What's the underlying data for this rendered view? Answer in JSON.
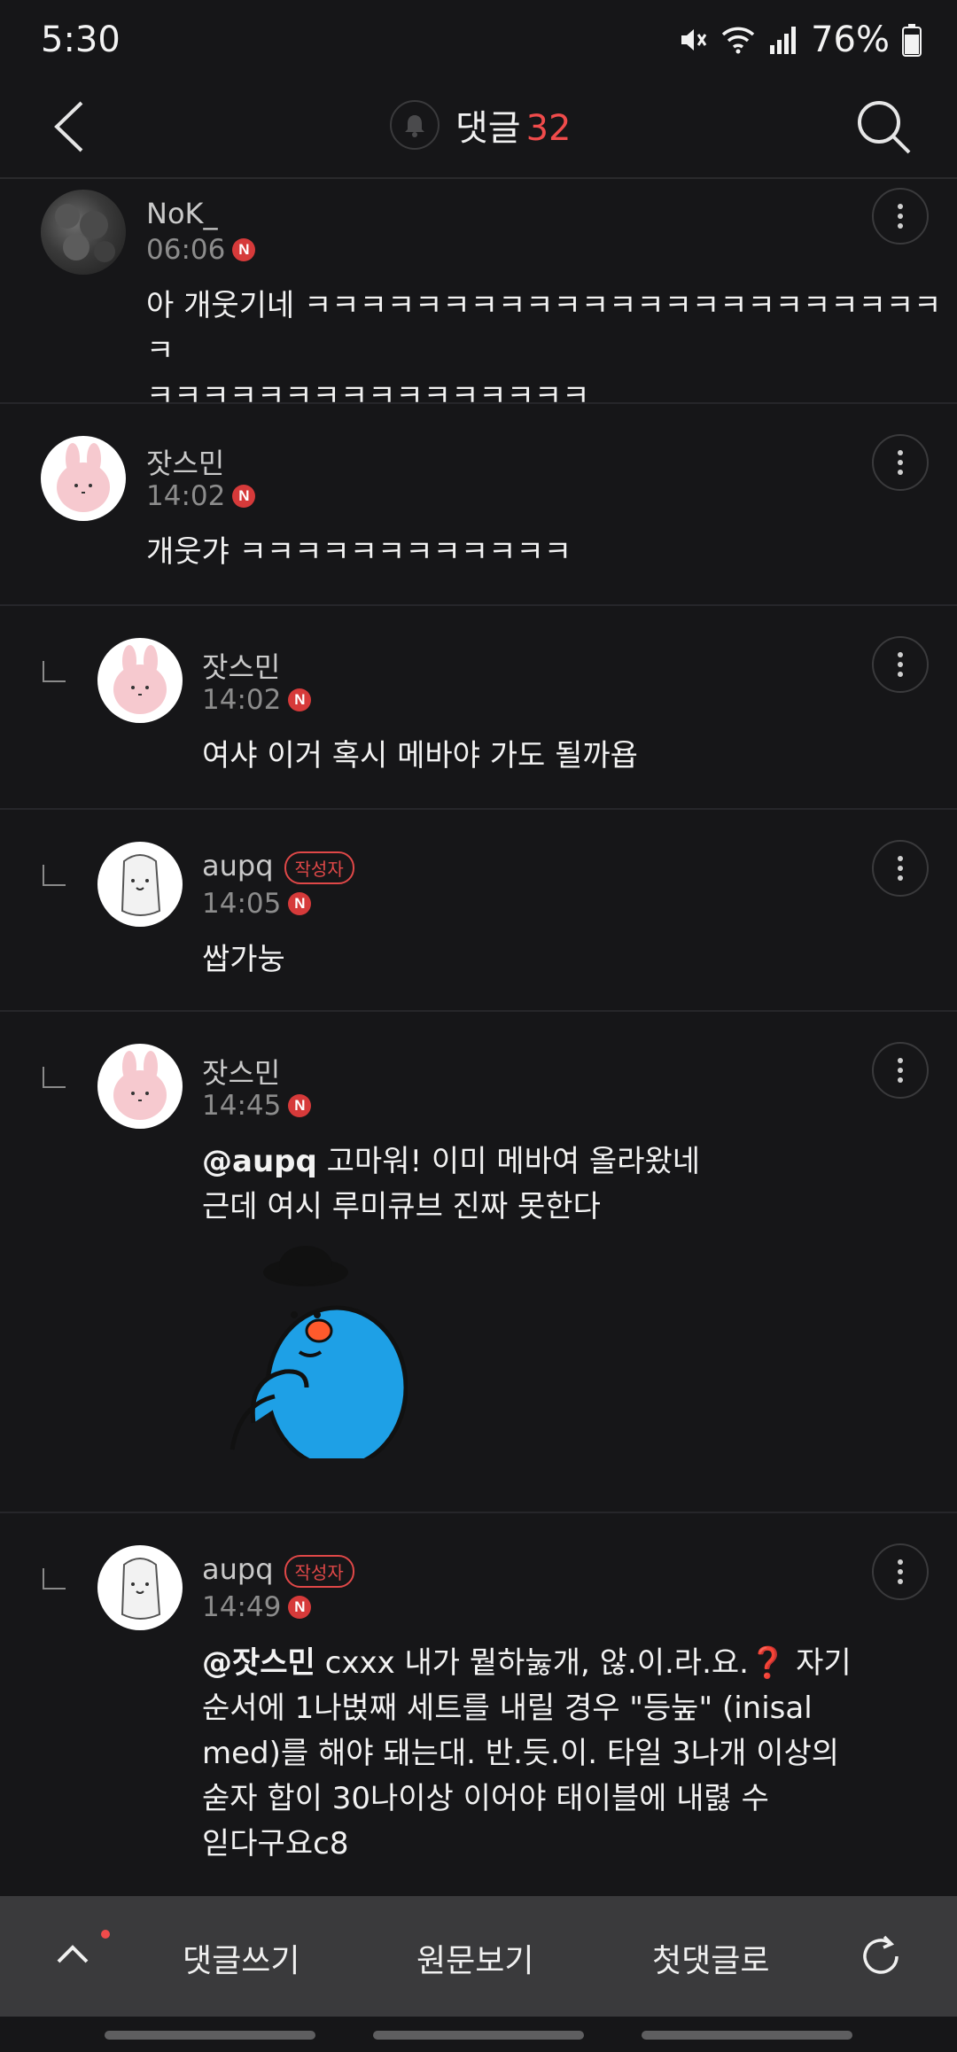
{
  "status": {
    "time": "5:30",
    "battery": "76%"
  },
  "header": {
    "title": "댓글",
    "count": "32"
  },
  "comments": [
    {
      "name": "NoK_",
      "time": "06:06",
      "text": [
        "아 개웃기네 ㅋㅋㅋㅋㅋㅋㅋㅋㅋㅋㅋㅋㅋㅋㅋㅋㅋㅋㅋㅋㅋㅋㅋㅋ",
        "ㅋㅋㅋㅋㅋㅋㅋㅋㅋㅋㅋㅋㅋㅋㅋㅋ"
      ]
    },
    {
      "name": "잣스민",
      "time": "14:02",
      "text": [
        "개웃갸 ㅋㅋㅋㅋㅋㅋㅋㅋㅋㅋㅋㅋ"
      ]
    },
    {
      "name": "잣스민",
      "time": "14:02",
      "text": [
        "여샤 이거 혹시 메바야 가도 될까욥"
      ]
    },
    {
      "name": "aupq",
      "author_tag": "작성자",
      "time": "14:05",
      "text": [
        "쌉가눙"
      ]
    },
    {
      "name": "잣스민",
      "time": "14:45",
      "mention": "@aupq",
      "text": [
        "고마워! 이미 메바여 올라왔네",
        "근데 여시 루미큐브 진짜 못한다"
      ]
    },
    {
      "name": "aupq",
      "author_tag": "작성자",
      "time": "14:49",
      "mention": "@잣스민",
      "text": [
        "cxxx 내가 뭩하눓개, 않.이.라.요.❓ 자기",
        "순서에 1나벉째 세트를 내릴 경우 \"등눞\" (inisal",
        "med)를 해야 돼는대. 반.듯.이. 타일 3나개 이상의",
        "숟자 합이 30나이상 이어야 태이블에 내렳 수",
        "읻다구요c8"
      ]
    }
  ],
  "badge_letter": "N",
  "bottom": {
    "write": "댓글쓰기",
    "original": "원문보기",
    "first": "첫댓글로"
  },
  "colors": {
    "accent": "#f04b4b",
    "background": "#161618",
    "bar": "#3a3a3c"
  }
}
